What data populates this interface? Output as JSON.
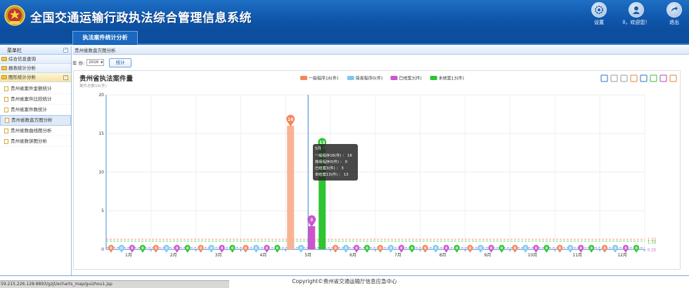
{
  "header": {
    "title": "全国交通运输行政执法综合管理信息系统",
    "buttons": [
      {
        "label": "设置",
        "icon": "gear-icon"
      },
      {
        "label": "ll，欢迎您！",
        "icon": "user-icon"
      },
      {
        "label": "退出",
        "icon": "exit-icon"
      }
    ]
  },
  "tabs": [
    {
      "label": "执法案件统计分析",
      "active": true
    }
  ],
  "sidebar": {
    "title": "菜单栏",
    "collapse": "«",
    "groups": [
      {
        "label": "综合信息查询"
      },
      {
        "label": "报表统计分析"
      },
      {
        "label": "图形统计分析",
        "open": true,
        "expander": "−"
      }
    ],
    "items": [
      {
        "label": "贵州省案件金额统计"
      },
      {
        "label": "贵州省案件比较统计"
      },
      {
        "label": "贵州省案件数统计"
      },
      {
        "label": "贵州省数直方图分析",
        "active": true
      },
      {
        "label": "贵州省数曲线图分析"
      },
      {
        "label": "贵州省数饼图分析"
      }
    ]
  },
  "breadcrumb": "贵州省数直方图分析",
  "filter": {
    "year_label": "年 份:",
    "year_value": "2016",
    "stat_button": "统计"
  },
  "chart_data": {
    "type": "bar",
    "title": "贵州省执法案件量",
    "subtitle": "案件总数16(件)",
    "categories": [
      "1月",
      "2月",
      "3月",
      "4月",
      "5月",
      "6月",
      "7月",
      "8月",
      "9月",
      "10月",
      "11月",
      "12月"
    ],
    "ylim": [
      0,
      20
    ],
    "yticks": [
      "0",
      "5",
      "10",
      "15",
      "20"
    ],
    "series": [
      {
        "name": "一般程序16(件)",
        "color": "#f4865a",
        "fill": "#f9b394",
        "values": [
          0,
          0,
          0,
          0,
          16,
          0,
          0,
          0,
          0,
          0,
          0,
          0
        ]
      },
      {
        "name": "简易程序0(件)",
        "color": "#7ec8f0",
        "fill": "#a8daf6",
        "values": [
          0,
          0,
          0,
          0,
          0,
          0,
          0,
          0,
          0,
          0,
          0,
          0
        ]
      },
      {
        "name": "已结案3(件)",
        "color": "#cc55cc",
        "fill": "#cc55cc",
        "values": [
          0,
          0,
          0,
          0,
          3,
          0,
          0,
          0,
          0,
          0,
          0,
          0
        ]
      },
      {
        "name": "未结案13(件)",
        "color": "#2fc431",
        "fill": "#2fc431",
        "values": [
          0,
          0,
          0,
          0,
          13,
          0,
          0,
          0,
          0,
          0,
          0,
          0
        ]
      }
    ],
    "markline_labels": [
      "1.33",
      "1.33",
      "0.25"
    ],
    "tooltip": {
      "title": "5月",
      "lines": [
        "一般程序16(件) ： 16",
        "简易程序0(件) ： 0",
        "已结案3(件) ： 3",
        "未结案13(件) ： 13"
      ]
    },
    "toolbox_icons": [
      "mark-icon",
      "markundo-icon",
      "markclear-icon",
      "dataview-icon",
      "line-icon",
      "bar-icon",
      "restore-icon",
      "save-icon"
    ]
  },
  "status_url": "59.215.226.128:8893/gzjt/echarts_map/guizhou1.jsp",
  "copyright": "Copyright©贵州省交通运输厅信息应急中心"
}
